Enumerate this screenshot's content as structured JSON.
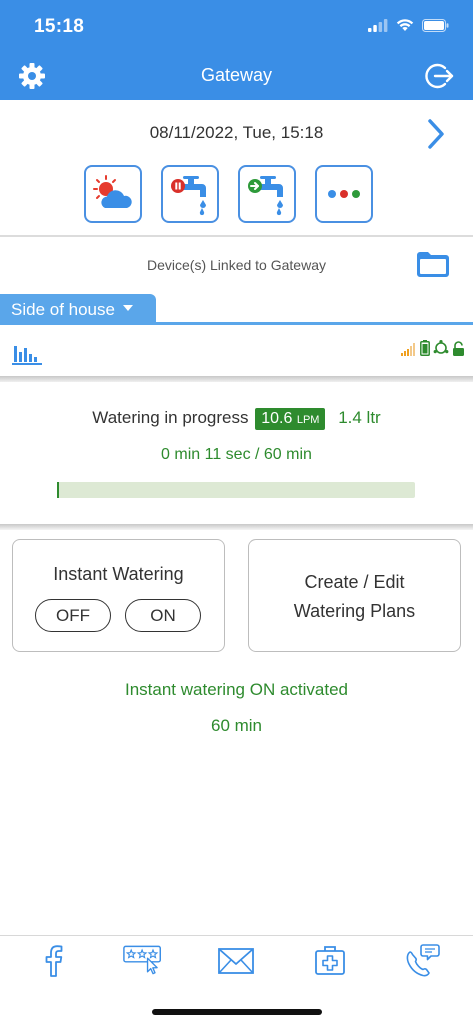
{
  "status_bar": {
    "time": "15:18"
  },
  "nav": {
    "title": "Gateway"
  },
  "header": {
    "datetime": "08/11/2022, Tue, 15:18"
  },
  "linked": {
    "label": "Device(s) Linked to Gateway"
  },
  "device": {
    "tab_label": "Side of house"
  },
  "watering": {
    "status_label": "Watering in progress",
    "flow_value": "10.6",
    "flow_unit": "LPM",
    "volume": "1.4 ltr",
    "time_progress": "0 min 11 sec / 60 min",
    "progress_fraction": 0.003
  },
  "instant": {
    "title": "Instant Watering",
    "off_label": "OFF",
    "on_label": "ON"
  },
  "plans": {
    "line1": "Create / Edit",
    "line2": "Watering Plans"
  },
  "message": {
    "activated": "Instant watering ON activated",
    "duration": "60 min"
  },
  "colors": {
    "brand_blue": "#3a8ee6",
    "tab_blue": "#5aa6ea",
    "active_green": "#2e8b2e"
  },
  "icons": {
    "nav_left": "gear-icon",
    "nav_right": "logout-icon",
    "tools": [
      "weather-icon",
      "tap-paused-icon",
      "tap-running-icon",
      "more-icon"
    ],
    "tab_bar": [
      "facebook-icon",
      "rating-icon",
      "mail-icon",
      "first-aid-icon",
      "support-chat-icon"
    ]
  }
}
